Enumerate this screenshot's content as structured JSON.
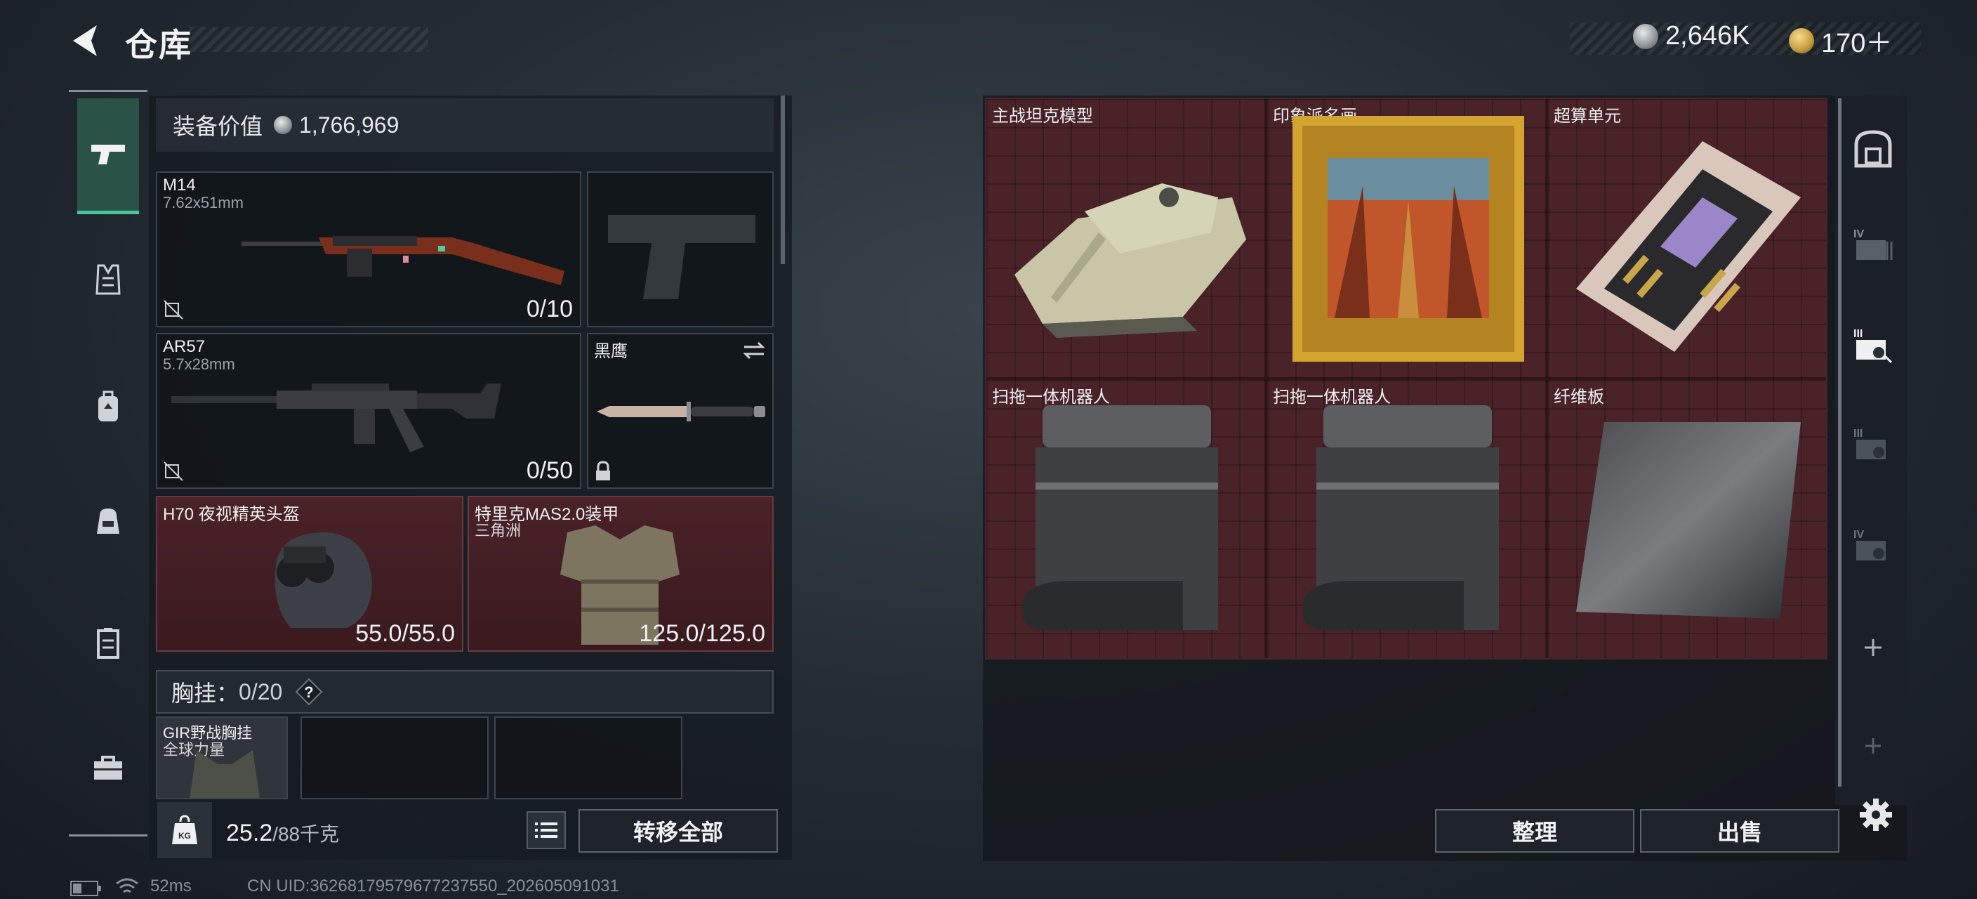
{
  "header": {
    "title": "仓库"
  },
  "currency": {
    "silver": "2,646K",
    "gold": "170＋"
  },
  "equipment": {
    "label": "装备价值",
    "value": "1,766,969"
  },
  "weapons": [
    {
      "name": "M14",
      "ammo": "7.62x51mm",
      "count": "0/10"
    },
    {
      "name": "AR57",
      "ammo": "5.7x28mm",
      "count": "0/50"
    }
  ],
  "pistol_slot": {
    "name": ""
  },
  "melee": {
    "name": "黑鹰"
  },
  "helmet": {
    "name": "H70 夜视精英头盔",
    "durability": "55.0/55.0"
  },
  "armor": {
    "name": "特里克MAS2.0装甲",
    "sub": "三角洲",
    "durability": "125.0/125.0"
  },
  "chest_rig": {
    "label": "胸挂：",
    "count": "0/20",
    "help": "?"
  },
  "rig_item": {
    "name": "GIR野战胸挂",
    "sub": "全球力量"
  },
  "weight": {
    "current": "25.2",
    "max": "/88千克"
  },
  "buttons": {
    "transfer_all": "转移全部",
    "sort": "整理",
    "sell": "出售"
  },
  "container_items": [
    {
      "name": "主战坦克模型"
    },
    {
      "name": "印象派名画"
    },
    {
      "name": "超算单元"
    },
    {
      "name": "扫拖一体机器人"
    },
    {
      "name": "扫拖一体机器人"
    },
    {
      "name": "纤维板"
    }
  ],
  "status": {
    "ping": "52ms",
    "uid": "CN UID:36268179579677237550_202605091031"
  },
  "colors": {
    "accent": "#45c79b",
    "rare_red": "#4a2329"
  }
}
